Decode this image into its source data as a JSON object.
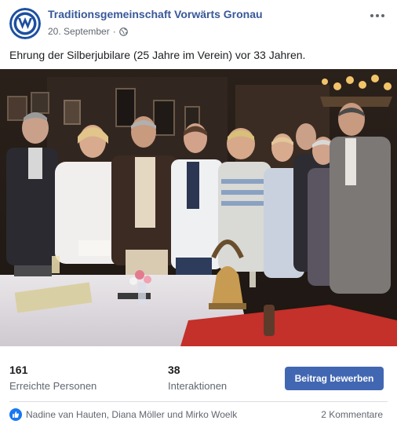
{
  "post": {
    "page_name": "Traditionsgemeinschaft Vorwärts Gronau",
    "date": "20. September",
    "date_separator": "·",
    "privacy_icon": "globe-icon",
    "more_icon": "more-options-icon",
    "caption": "Ehrung der Silberjubilare (25 Jahre im Verein) vor 33 Jahren.",
    "avatar_logo_text": "VG"
  },
  "stats": {
    "reached_value": "161",
    "reached_label": "Erreichte Personen",
    "interactions_value": "38",
    "interactions_label": "Interaktionen",
    "boost_label": "Beitrag bewerben"
  },
  "footer": {
    "reaction_icon": "like-icon",
    "reactions_text": "Nadine van Hauten, Diana Möller und Mirko Woelk",
    "comments_text": "2 Kommentare"
  },
  "colors": {
    "link": "#385898",
    "button": "#4267b2",
    "like": "#1877f2",
    "muted": "#606770"
  }
}
